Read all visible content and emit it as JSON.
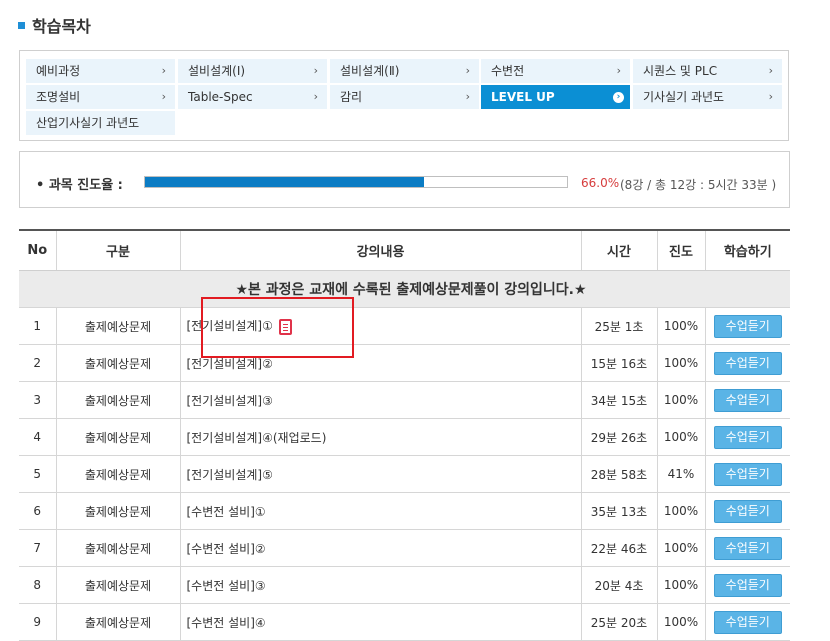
{
  "page_title": "학습목차",
  "chapters": [
    {
      "label": "예비과정",
      "active": false
    },
    {
      "label": "설비설계(Ⅰ)",
      "active": false
    },
    {
      "label": "설비설계(Ⅱ)",
      "active": false
    },
    {
      "label": "수변전",
      "active": false
    },
    {
      "label": "시퀀스 및 PLC",
      "active": false
    },
    {
      "label": "조명설비",
      "active": false
    },
    {
      "label": "Table-Spec",
      "active": false
    },
    {
      "label": "감리",
      "active": false
    },
    {
      "label": "LEVEL UP",
      "active": true
    },
    {
      "label": "기사실기 과년도",
      "active": false
    },
    {
      "label": "산업기사실기 과년도",
      "active": false
    }
  ],
  "progress": {
    "label": "• 과목 진도율 :",
    "percent_text": "66.0%",
    "fraction": 0.66,
    "detail": "(8강 / 총 12강 : 5시간 33분 )"
  },
  "table": {
    "headers": [
      "No",
      "구분",
      "강의내용",
      "시간",
      "진도",
      "학습하기"
    ],
    "notice": "★본 과정은 교재에 수록된 출제예상문제풀이 강의입니다.★",
    "button_label": "수업듣기",
    "rows": [
      {
        "no": "1",
        "category": "출제예상문제",
        "content": "[전기설비설계]①",
        "time": "25분 1초",
        "progress": "100%",
        "doc_icon": true
      },
      {
        "no": "2",
        "category": "출제예상문제",
        "content": "[전기설비설계]②",
        "time": "15분 16초",
        "progress": "100%",
        "doc_icon": false
      },
      {
        "no": "3",
        "category": "출제예상문제",
        "content": "[전기설비설계]③",
        "time": "34분 15초",
        "progress": "100%",
        "doc_icon": false
      },
      {
        "no": "4",
        "category": "출제예상문제",
        "content": "[전기설비설계]④(재업로드)",
        "time": "29분 26초",
        "progress": "100%",
        "doc_icon": false
      },
      {
        "no": "5",
        "category": "출제예상문제",
        "content": "[전기설비설계]⑤",
        "time": "28분 58초",
        "progress": "41%",
        "doc_icon": false
      },
      {
        "no": "6",
        "category": "출제예상문제",
        "content": "[수변전 설비]①",
        "time": "35분 13초",
        "progress": "100%",
        "doc_icon": false
      },
      {
        "no": "7",
        "category": "출제예상문제",
        "content": "[수변전 설비]②",
        "time": "22분 46초",
        "progress": "100%",
        "doc_icon": false
      },
      {
        "no": "8",
        "category": "출제예상문제",
        "content": "[수변전 설비]③",
        "time": "20분 4초",
        "progress": "100%",
        "doc_icon": false
      },
      {
        "no": "9",
        "category": "출제예상문제",
        "content": "[수변전 설비]④",
        "time": "25분 20초",
        "progress": "100%",
        "doc_icon": false
      }
    ]
  },
  "colors": {
    "accent": "#0b8fd4",
    "progress_fill": "#0b7cc4",
    "highlight": "#e21b22",
    "button": "#5ab4e6"
  }
}
